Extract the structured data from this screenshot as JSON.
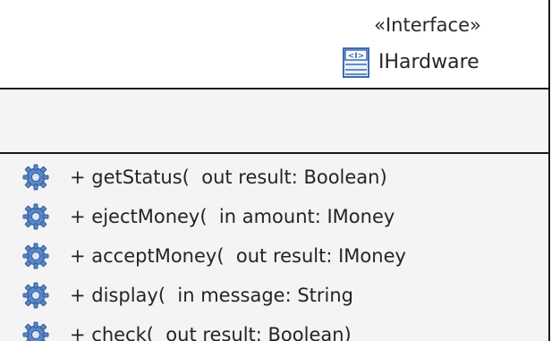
{
  "interface": {
    "stereotype": "«Interface»",
    "name": "IHardware",
    "icon": "interface-icon"
  },
  "operations": [
    {
      "text": "+ getStatus(  out result: Boolean)",
      "icon": "operation-gear-icon"
    },
    {
      "text": "+ ejectMoney(  in amount: IMoney",
      "icon": "operation-gear-icon"
    },
    {
      "text": "+ acceptMoney(  out result: IMoney",
      "icon": "operation-gear-icon"
    },
    {
      "text": "+ display(  in message: String",
      "icon": "operation-gear-icon"
    },
    {
      "text": "+ check(  out result: Boolean)",
      "icon": "operation-gear-icon"
    }
  ],
  "colors": {
    "border": "#1a1a1a",
    "compartment_bg": "#f4f4f4",
    "gear_blue": "#5b87c8",
    "icon_blue": "#3d6bb0"
  }
}
